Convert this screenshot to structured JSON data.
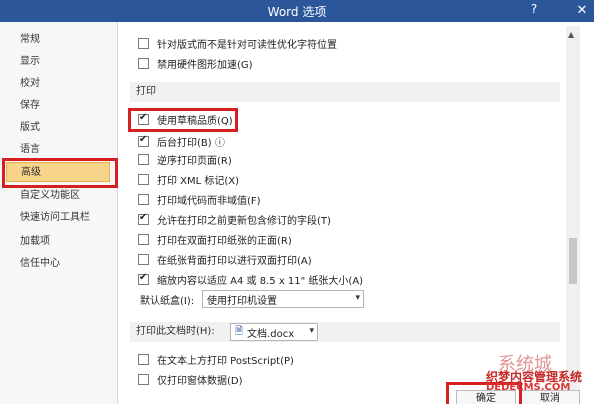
{
  "window": {
    "title": "Word 选项",
    "help_label": "?",
    "close_label": "✕"
  },
  "sidebar": {
    "items": [
      {
        "label": "常规"
      },
      {
        "label": "显示"
      },
      {
        "label": "校对"
      },
      {
        "label": "保存"
      },
      {
        "label": "版式"
      },
      {
        "label": "语言"
      },
      {
        "label": "高级",
        "active": true
      },
      {
        "label": "自定义功能区"
      },
      {
        "label": "快速访问工具栏"
      },
      {
        "label": "加载项"
      },
      {
        "label": "信任中心"
      }
    ]
  },
  "content": {
    "top_options": [
      {
        "label": "针对版式而不是针对可读性优化字符位置",
        "checked": false
      },
      {
        "label": "禁用硬件图形加速(G)",
        "checked": false
      }
    ],
    "print_section": {
      "title": "打印",
      "options": [
        {
          "label": "使用草稿品质(Q)",
          "checked": true
        },
        {
          "label": "后台打印(B) ⓘ",
          "checked": true
        },
        {
          "label": "逆序打印页面(R)",
          "checked": false
        },
        {
          "label": "打印 XML 标记(X)",
          "checked": false
        },
        {
          "label": "打印域代码而非域值(F)",
          "checked": false
        },
        {
          "label": "允许在打印之前更新包含修订的字段(T)",
          "checked": true
        },
        {
          "label": "打印在双面打印纸张的正面(R)",
          "checked": false
        },
        {
          "label": "在纸张背面打印以进行双面打印(A)",
          "checked": false
        },
        {
          "label": "缩放内容以适应 A4 或 8.5 x 11\" 纸张大小(A)",
          "checked": true
        }
      ],
      "default_tray_label": "默认纸盒(I):",
      "default_tray_value": "使用打印机设置"
    },
    "doc_print_section": {
      "title": "打印此文档时(H):",
      "doc_name": "文档.docx",
      "options": [
        {
          "label": "在文本上方打印 PostScript(P)",
          "checked": false
        },
        {
          "label": "仅打印窗体数据(D)",
          "checked": false
        }
      ]
    }
  },
  "footer": {
    "ok_label": "确定",
    "cancel_label": "取消"
  },
  "watermark": {
    "line1": "系统城",
    "line2": "织梦内容管理系统",
    "line3": "DEDECMS.COM"
  },
  "colors": {
    "titlebar": "#2b579a",
    "highlight": "#d61f1f",
    "active_item": "#f6d58a"
  }
}
